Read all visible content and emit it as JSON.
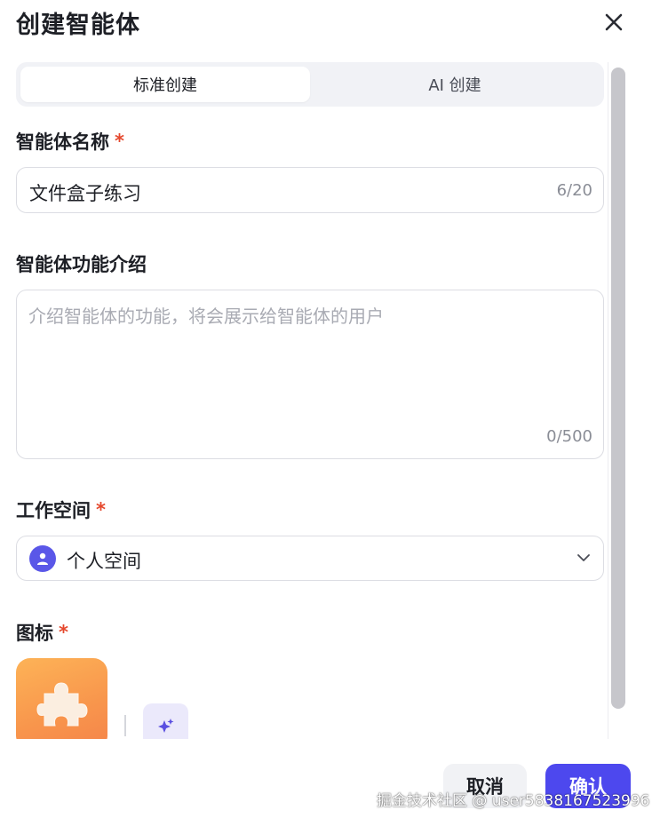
{
  "dialog": {
    "title": "创建智能体",
    "close_icon": "close-icon"
  },
  "tabs": [
    {
      "label": "标准创建",
      "active": true
    },
    {
      "label": "AI 创建",
      "active": false
    }
  ],
  "fields": {
    "name": {
      "label": "智能体名称",
      "required_mark": "*",
      "value": "文件盒子练习",
      "counter": "6/20"
    },
    "description": {
      "label": "智能体功能介绍",
      "placeholder": "介绍智能体的功能，将会展示给智能体的用户",
      "counter": "0/500"
    },
    "workspace": {
      "label": "工作空间",
      "required_mark": "*",
      "value": "个人空间",
      "avatar_icon": "user-icon",
      "dropdown_icon": "chevron-down-icon"
    },
    "icon": {
      "label": "图标",
      "required_mark": "*",
      "selected_icon": "puzzle-piece-icon",
      "ai_generate_icon": "sparkle-icon"
    }
  },
  "footer": {
    "cancel_label": "取消",
    "confirm_label": "确认"
  },
  "watermark": "掘金技术社区 @ user5838167523996",
  "colors": {
    "accent": "#4d48ee",
    "required": "#e5482d",
    "icon_gradient_top": "#fdb357",
    "icon_gradient_bottom": "#f5844a"
  }
}
